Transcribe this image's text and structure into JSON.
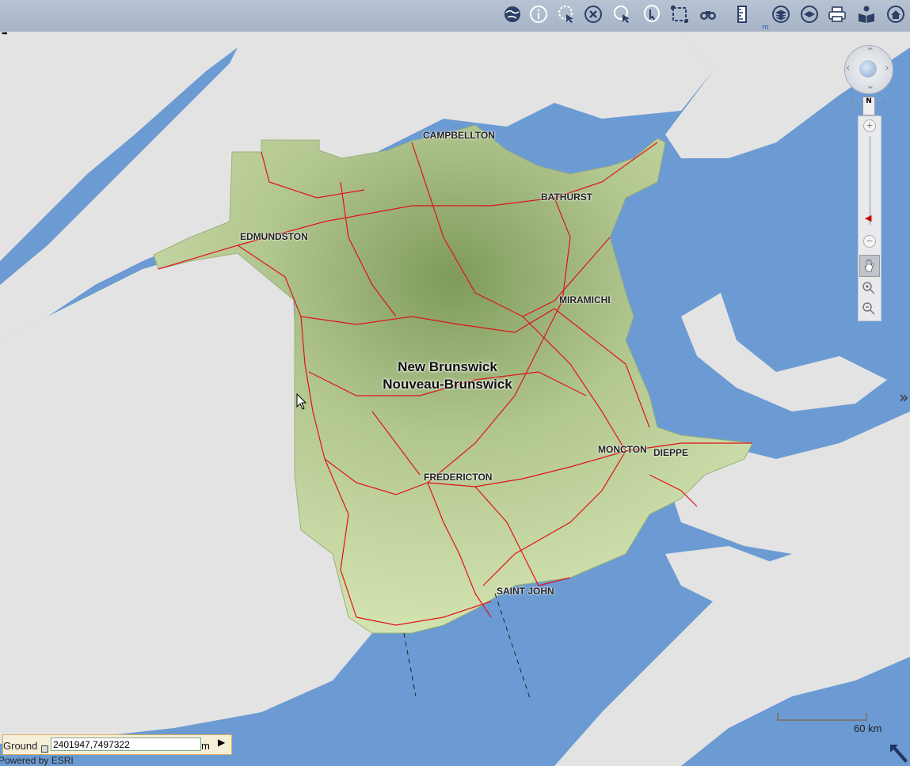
{
  "toolbar": {
    "tools": [
      {
        "name": "globe-icon"
      },
      {
        "name": "info-icon"
      },
      {
        "name": "query-icon"
      },
      {
        "name": "clear-icon"
      },
      {
        "name": "select-icon"
      },
      {
        "name": "identify-icon"
      },
      {
        "name": "select-area-icon"
      },
      {
        "name": "binoculars-icon"
      },
      {
        "name": "measure-icon"
      },
      {
        "name": "layers-icon"
      },
      {
        "name": "layer-toggle-icon"
      },
      {
        "name": "print-icon"
      },
      {
        "name": "help-reader-icon"
      },
      {
        "name": "home-icon"
      }
    ],
    "tiny_m": "m"
  },
  "map": {
    "province_line1": "New Brunswick",
    "province_line2": "Nouveau-Brunswick",
    "cities": {
      "campbellton": "CAMPBELLTON",
      "bathurst": "BATHURST",
      "edmundston": "EDMUNDSTON",
      "miramichi": "MIRAMICHI",
      "moncton": "MONCTON",
      "dieppe": "DIEPPE",
      "fredericton": "FREDERICTON",
      "saint_john": "SAINT JOHN"
    },
    "colors": {
      "water": "#6b9bd2",
      "land": "#e3e3e3",
      "province": "#c8d7a0",
      "roads": "#e0121a"
    }
  },
  "nav": {
    "north": "N",
    "zoom_in": "+",
    "zoom_out": "−"
  },
  "scale": {
    "label": "60 km"
  },
  "coords": {
    "label": "Ground",
    "value": "2401947,7497322",
    "unit": "m"
  },
  "footer": {
    "powered": "Powered by ESRI"
  }
}
